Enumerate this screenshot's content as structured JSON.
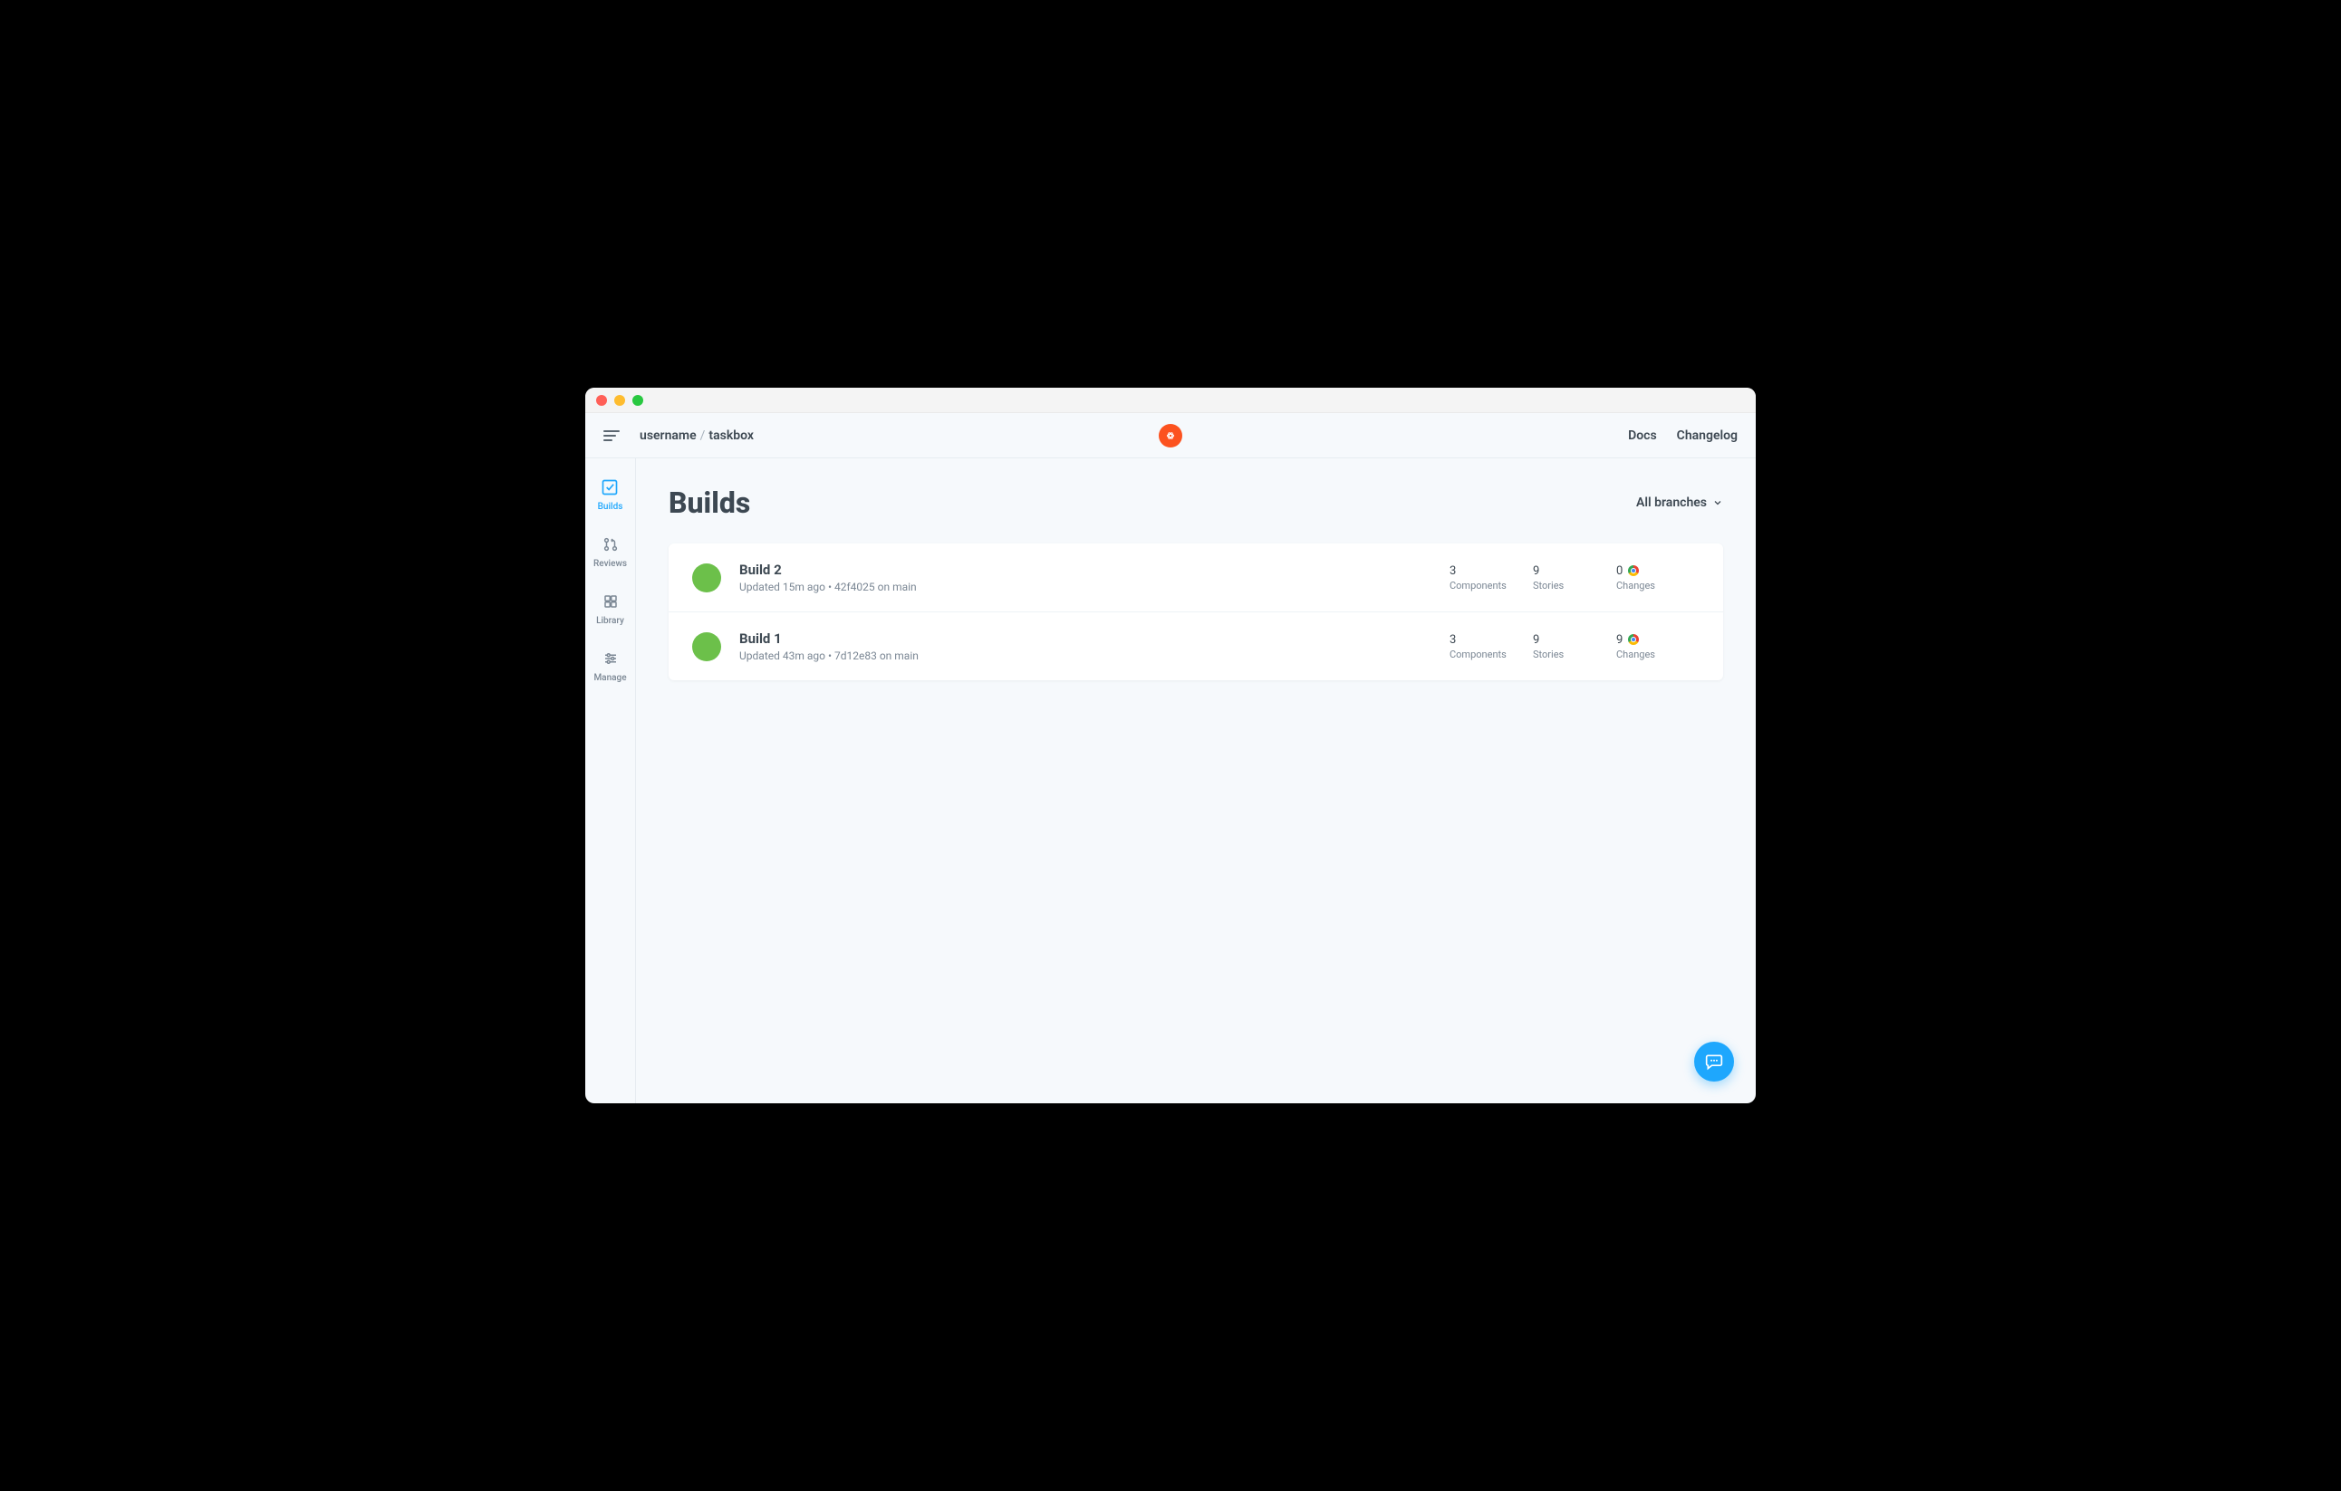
{
  "breadcrumb": {
    "username": "username",
    "project": "taskbox"
  },
  "topbar": {
    "docs": "Docs",
    "changelog": "Changelog"
  },
  "sidebar": {
    "items": [
      {
        "label": "Builds"
      },
      {
        "label": "Reviews"
      },
      {
        "label": "Library"
      },
      {
        "label": "Manage"
      }
    ]
  },
  "page": {
    "title": "Builds",
    "filter": "All branches"
  },
  "stat_labels": {
    "components": "Components",
    "stories": "Stories",
    "changes": "Changes"
  },
  "builds": [
    {
      "title": "Build 2",
      "updated_prefix": "Updated ",
      "updated": "15m ago",
      "bullet": " • ",
      "commit": "42f4025",
      "branch_prefix": " on ",
      "branch": "main",
      "components": "3",
      "stories": "9",
      "changes": "0"
    },
    {
      "title": "Build 1",
      "updated_prefix": "Updated ",
      "updated": "43m ago",
      "bullet": " • ",
      "commit": "7d12e83",
      "branch_prefix": " on ",
      "branch": "main",
      "components": "3",
      "stories": "9",
      "changes": "9"
    }
  ]
}
